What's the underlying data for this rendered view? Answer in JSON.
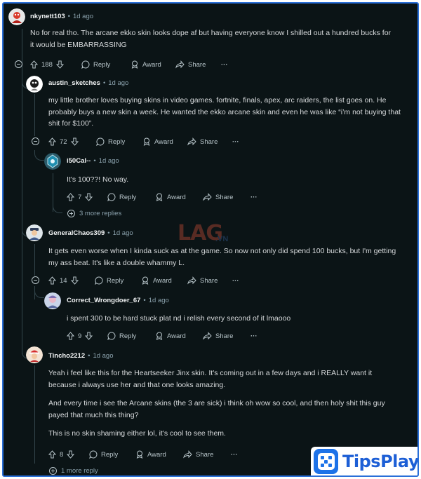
{
  "comments": [
    {
      "user": "nkynett103",
      "age": "1d ago",
      "body": [
        "No for real tho. The arcane ekko skin looks dope af but having everyone know I shilled out a hundred bucks for it would be EMBARRASSING"
      ],
      "score": "188"
    },
    {
      "user": "austin_sketches",
      "age": "1d ago",
      "body": [
        "my little brother loves buying skins in video games. fortnite, finals, apex, arc raiders, the list goes on. He probably buys a new skin a week. He wanted the ekko arcane skin and even he was like “i’m not buying that shit for $100”."
      ],
      "score": "72"
    },
    {
      "user": "i50Cal--",
      "age": "1d ago",
      "body": [
        "It's 100??! No way."
      ],
      "score": "7",
      "more_replies": "3 more replies"
    },
    {
      "user": "GeneralChaos309",
      "age": "1d ago",
      "body": [
        "It gets even worse when I kinda suck as at the game. So now not only did spend 100 bucks, but I'm getting my ass beat. It's like a double whammy L."
      ],
      "score": "14"
    },
    {
      "user": "Correct_Wrongdoer_67",
      "age": "1d ago",
      "body": [
        "i spent 300 to be hard stuck plat nd i relish every second of it lmaooo"
      ],
      "score": "9"
    },
    {
      "user": "Tincho2212",
      "age": "1d ago",
      "body": [
        "Yeah i feel like this for the Heartseeker Jinx skin. It's coming out in a few days and i REALLY want it because i always use her and that one looks amazing.",
        "And every time i see the Arcane skins (the 3 are sick) i think oh wow so cool, and then holy shit this guy payed that much this thing?",
        "This is no skin shaming either lol, it's cool to see them."
      ],
      "score": "8",
      "more_replies": "1 more reply"
    }
  ],
  "actions": {
    "reply": "Reply",
    "award": "Award",
    "share": "Share",
    "more": "···",
    "separator": "•"
  },
  "watermark": {
    "text": "LAG",
    "suffix": ".VN"
  },
  "brand": {
    "name": "TipsPlay"
  },
  "colors": {
    "background": "#0b1416",
    "frame_border": "#2a6fd8",
    "text": "#d7dadc",
    "muted": "#8ba2ad",
    "brand": "#1d72e8"
  }
}
